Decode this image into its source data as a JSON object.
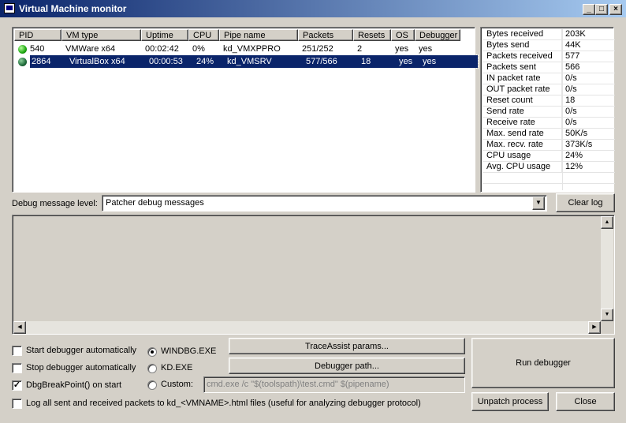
{
  "window": {
    "title": "Virtual Machine monitor",
    "min_glyph": "_",
    "max_glyph": "□",
    "close_glyph": "×"
  },
  "process_list": {
    "columns": [
      "PID",
      "VM type",
      "Uptime",
      "CPU",
      "Pipe name",
      "Packets",
      "Resets",
      "OS",
      "Debugger"
    ],
    "rows": [
      {
        "pid": "540",
        "vm_type": "VMWare x64",
        "uptime": "00:02:42",
        "cpu": "0%",
        "pipe": "kd_VMXPPRO",
        "packets": "251/252",
        "resets": "2",
        "os": "yes",
        "debugger": "yes",
        "selected": false,
        "status_icon": "green-status-icon"
      },
      {
        "pid": "2864",
        "vm_type": "VirtualBox x64",
        "uptime": "00:00:53",
        "cpu": "24%",
        "pipe": "kd_VMSRV",
        "packets": "577/566",
        "resets": "18",
        "os": "yes",
        "debugger": "yes",
        "selected": true,
        "status_icon": "dark-green-status-icon"
      }
    ]
  },
  "stats": [
    {
      "label": "Bytes received",
      "value": "203K"
    },
    {
      "label": "Bytes send",
      "value": "44K"
    },
    {
      "label": "Packets received",
      "value": "577"
    },
    {
      "label": "Packets sent",
      "value": "566"
    },
    {
      "label": "IN packet rate",
      "value": "0/s"
    },
    {
      "label": "OUT packet rate",
      "value": "0/s"
    },
    {
      "label": "Reset count",
      "value": "18"
    },
    {
      "label": "Send rate",
      "value": "0/s"
    },
    {
      "label": "Receive rate",
      "value": "0/s"
    },
    {
      "label": "Max. send rate",
      "value": "50K/s"
    },
    {
      "label": "Max. recv. rate",
      "value": "373K/s"
    },
    {
      "label": "CPU usage",
      "value": "24%"
    },
    {
      "label": "Avg. CPU usage",
      "value": "12%"
    }
  ],
  "debug": {
    "level_label": "Debug message level:",
    "level_value": "Patcher debug messages",
    "clear_log": "Clear log"
  },
  "options": {
    "start_auto": {
      "label": "Start debugger automatically",
      "checked": false
    },
    "stop_auto": {
      "label": "Stop debugger automatically",
      "checked": false
    },
    "dbgbreak": {
      "label": "DbgBreakPoint() on start",
      "checked": true
    },
    "log_packets": {
      "label": "Log all sent and received packets to kd_<VMNAME>.html files (useful for analyzing debugger protocol)",
      "checked": false
    },
    "check_mark": "✓"
  },
  "debugger_choice": {
    "windbg": "WINDBG.EXE",
    "kd": "KD.EXE",
    "custom": "Custom:",
    "selected": "windbg",
    "custom_command": "cmd.exe /c \"$(toolspath)\\test.cmd\" $(pipename)"
  },
  "buttons": {
    "traceassist": "TraceAssist params...",
    "debugger_path": "Debugger path...",
    "run_debugger": "Run debugger",
    "unpatch": "Unpatch process",
    "close": "Close"
  },
  "colors": {
    "face": "#d4d0c8",
    "selection": "#0a246a",
    "title_start": "#0a246a",
    "title_end": "#a6caf0"
  }
}
